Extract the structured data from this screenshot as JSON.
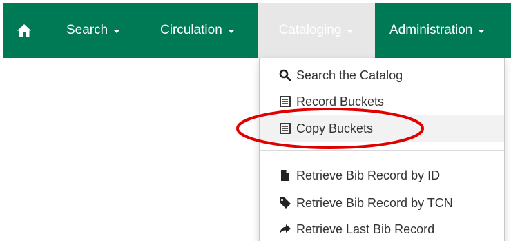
{
  "navbar": {
    "home_icon": "home-icon",
    "items": [
      {
        "label": "Search"
      },
      {
        "label": "Circulation"
      },
      {
        "label": "Cataloging"
      },
      {
        "label": "Administration"
      }
    ]
  },
  "dropdown": {
    "items": [
      {
        "label": "Search the Catalog",
        "icon": "search-icon"
      },
      {
        "label": "Record Buckets",
        "icon": "list-icon"
      },
      {
        "label": "Copy Buckets",
        "icon": "list-icon"
      },
      {
        "label": "Retrieve Bib Record by ID",
        "icon": "file-icon"
      },
      {
        "label": "Retrieve Bib Record by TCN",
        "icon": "tag-icon"
      },
      {
        "label": "Retrieve Last Bib Record",
        "icon": "share-arrow-icon"
      }
    ]
  },
  "colors": {
    "navbar_bg": "#007a54",
    "active_tab_bg": "#e7e7e7",
    "annotation": "#e00000"
  }
}
